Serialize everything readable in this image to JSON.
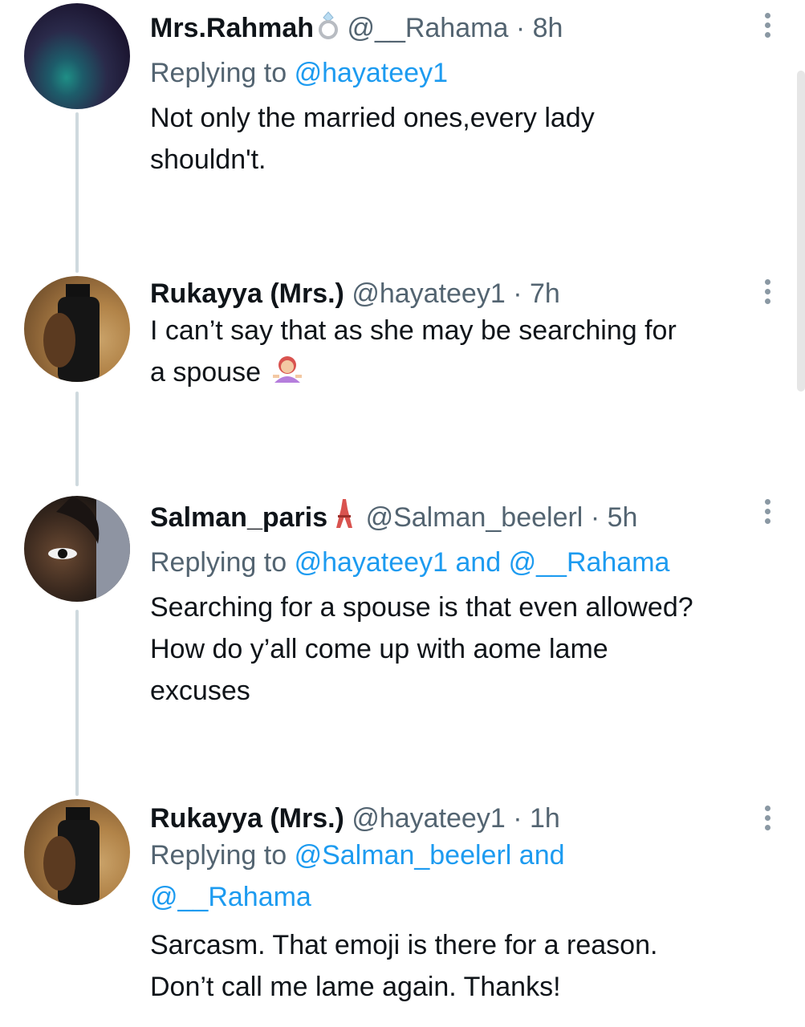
{
  "tweets": [
    {
      "name": "Mrs.Rahmah",
      "name_icon": "ring-emoji",
      "handle": "@__Rahama",
      "time": "8h",
      "reply_prefix": "Replying to",
      "reply_links": [
        "@hayateey1"
      ],
      "reply_sep": "",
      "lines": [
        "Not only the married ones,every lady",
        "shouldn't."
      ]
    },
    {
      "name": "Rukayya (Mrs.)",
      "handle": "@hayateey1",
      "time": "7h",
      "lines": [
        "I can’t say that as she may be searching for",
        "a spouse"
      ],
      "trailing_icon": "person-shrugging-emoji"
    },
    {
      "name": "Salman_paris",
      "name_icon": "eiffel-tower-emoji",
      "handle": "@Salman_beelerl",
      "time": "5h",
      "reply_prefix": "Replying to",
      "reply_links": [
        "@hayateey1",
        "@__Rahama"
      ],
      "reply_sep": "and",
      "lines": [
        "Searching for a spouse is that even allowed?",
        "How do y’all come up with aome lame",
        "excuses"
      ]
    },
    {
      "name": "Rukayya (Mrs.)",
      "handle": "@hayateey1",
      "time": "1h",
      "reply_prefix": "Replying to",
      "reply_links": [
        "@Salman_beelerl",
        "@__Rahama"
      ],
      "reply_sep": "and",
      "lines": [
        "Sarcasm. That emoji is there for a reason.",
        "Don’t call me lame again. Thanks!"
      ]
    }
  ],
  "dot_separator": "·",
  "colors": {
    "link": "#1d9bf0",
    "muted": "#536471",
    "text": "#0f1419",
    "thread_line": "#cfd9de"
  }
}
